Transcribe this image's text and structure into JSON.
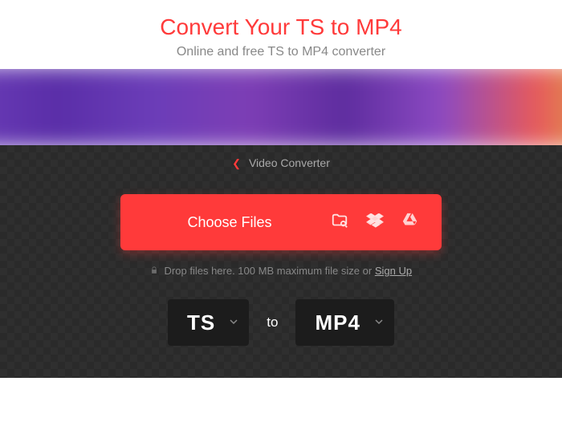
{
  "header": {
    "title": "Convert Your TS to MP4",
    "title_color": "#ff3a3a",
    "subtitle": "Online and free TS to MP4 converter"
  },
  "breadcrumb": {
    "label": "Video Converter"
  },
  "choose": {
    "label": "Choose Files"
  },
  "drop_hint": {
    "prefix": "Drop files here. 100 MB maximum file size or ",
    "link": "Sign Up"
  },
  "formats": {
    "source": "TS",
    "to_label": "to",
    "target": "MP4"
  }
}
